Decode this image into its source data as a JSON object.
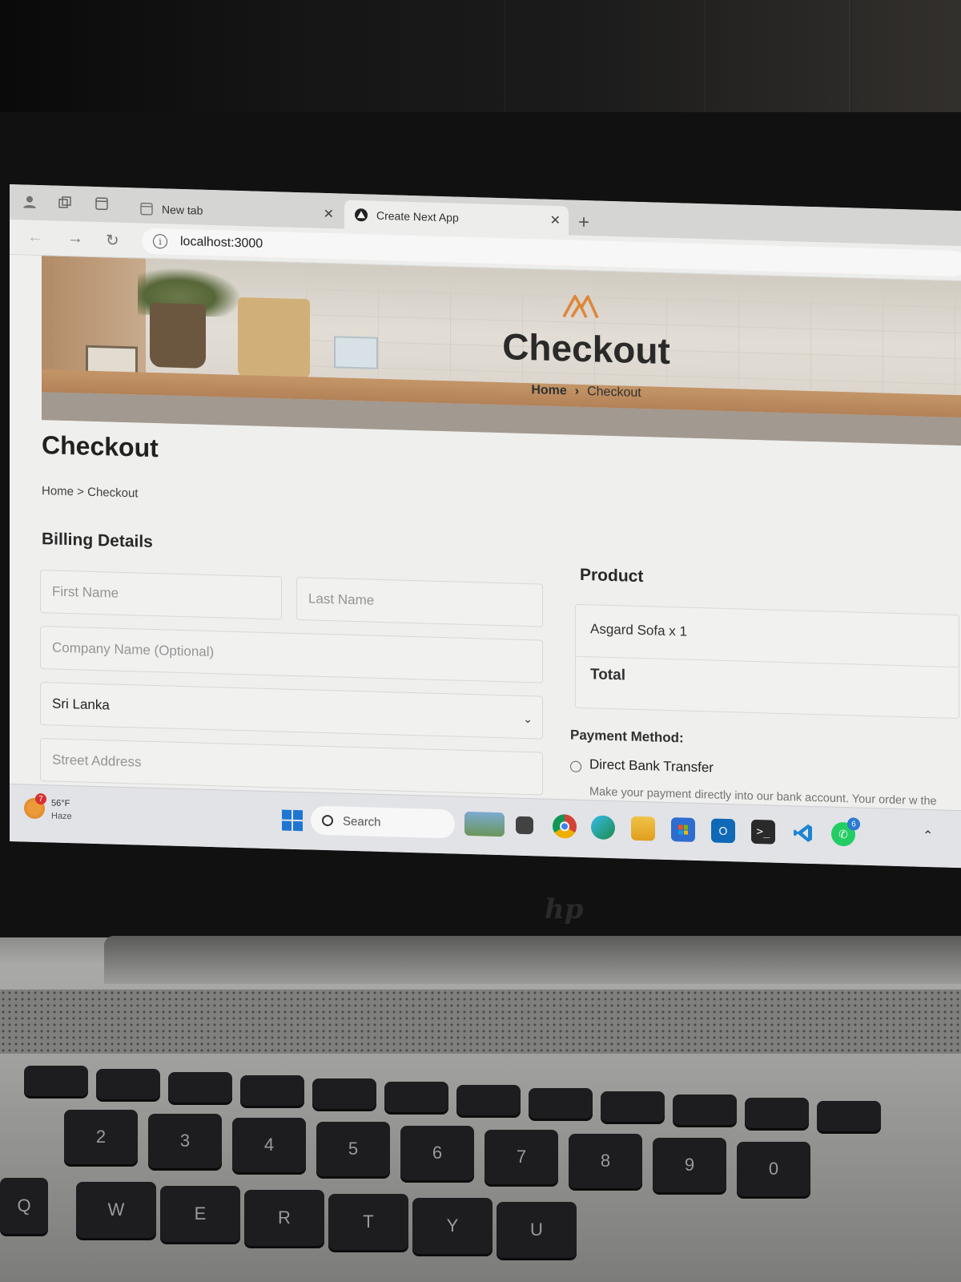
{
  "browser": {
    "tabs": [
      {
        "label": "New tab",
        "active": false
      },
      {
        "label": "Create Next App",
        "active": true
      }
    ],
    "address": "localhost:3000"
  },
  "hero": {
    "title": "Checkout",
    "breadcrumb_home": "Home",
    "breadcrumb_current": "Checkout"
  },
  "page": {
    "title": "Checkout",
    "breadcrumb": "Home > Checkout"
  },
  "billing": {
    "title": "Billing Details",
    "first_name_placeholder": "First Name",
    "last_name_placeholder": "Last Name",
    "company_placeholder": "Company Name (Optional)",
    "country_value": "Sri Lanka",
    "street_placeholder": "Street Address"
  },
  "order": {
    "title": "Product",
    "item": "Asgard Sofa x 1",
    "total_label": "Total"
  },
  "payment": {
    "title": "Payment Method:",
    "option": "Direct Bank Transfer",
    "description": "Make your payment directly into our bank account. Your order w the funds have cleared in our account."
  },
  "taskbar": {
    "weather_badge": "7",
    "temperature": "56°F",
    "condition": "Haze",
    "search_label": "Search",
    "whatsapp_badge": "6",
    "icons": [
      "widgets-icon",
      "terminal-icon",
      "chrome-icon",
      "edge-icon",
      "file-explorer-icon",
      "store-icon",
      "outlook-icon",
      "terminal-app-icon",
      "vscode-icon",
      "whatsapp-icon"
    ]
  },
  "keyboard": {
    "number_keys": [
      "2",
      "3",
      "4",
      "5",
      "6",
      "7",
      "8",
      "9",
      "0"
    ],
    "number_symbols": [
      "@",
      "#",
      "$",
      "%",
      "^",
      "&",
      "*",
      "(",
      ")"
    ],
    "letter_keys": [
      "Q",
      "W",
      "E",
      "R",
      "T",
      "Y",
      "U"
    ]
  },
  "colors": {
    "logo_orange": "#e58a3a",
    "windows_blue": "#1f7ad9"
  }
}
